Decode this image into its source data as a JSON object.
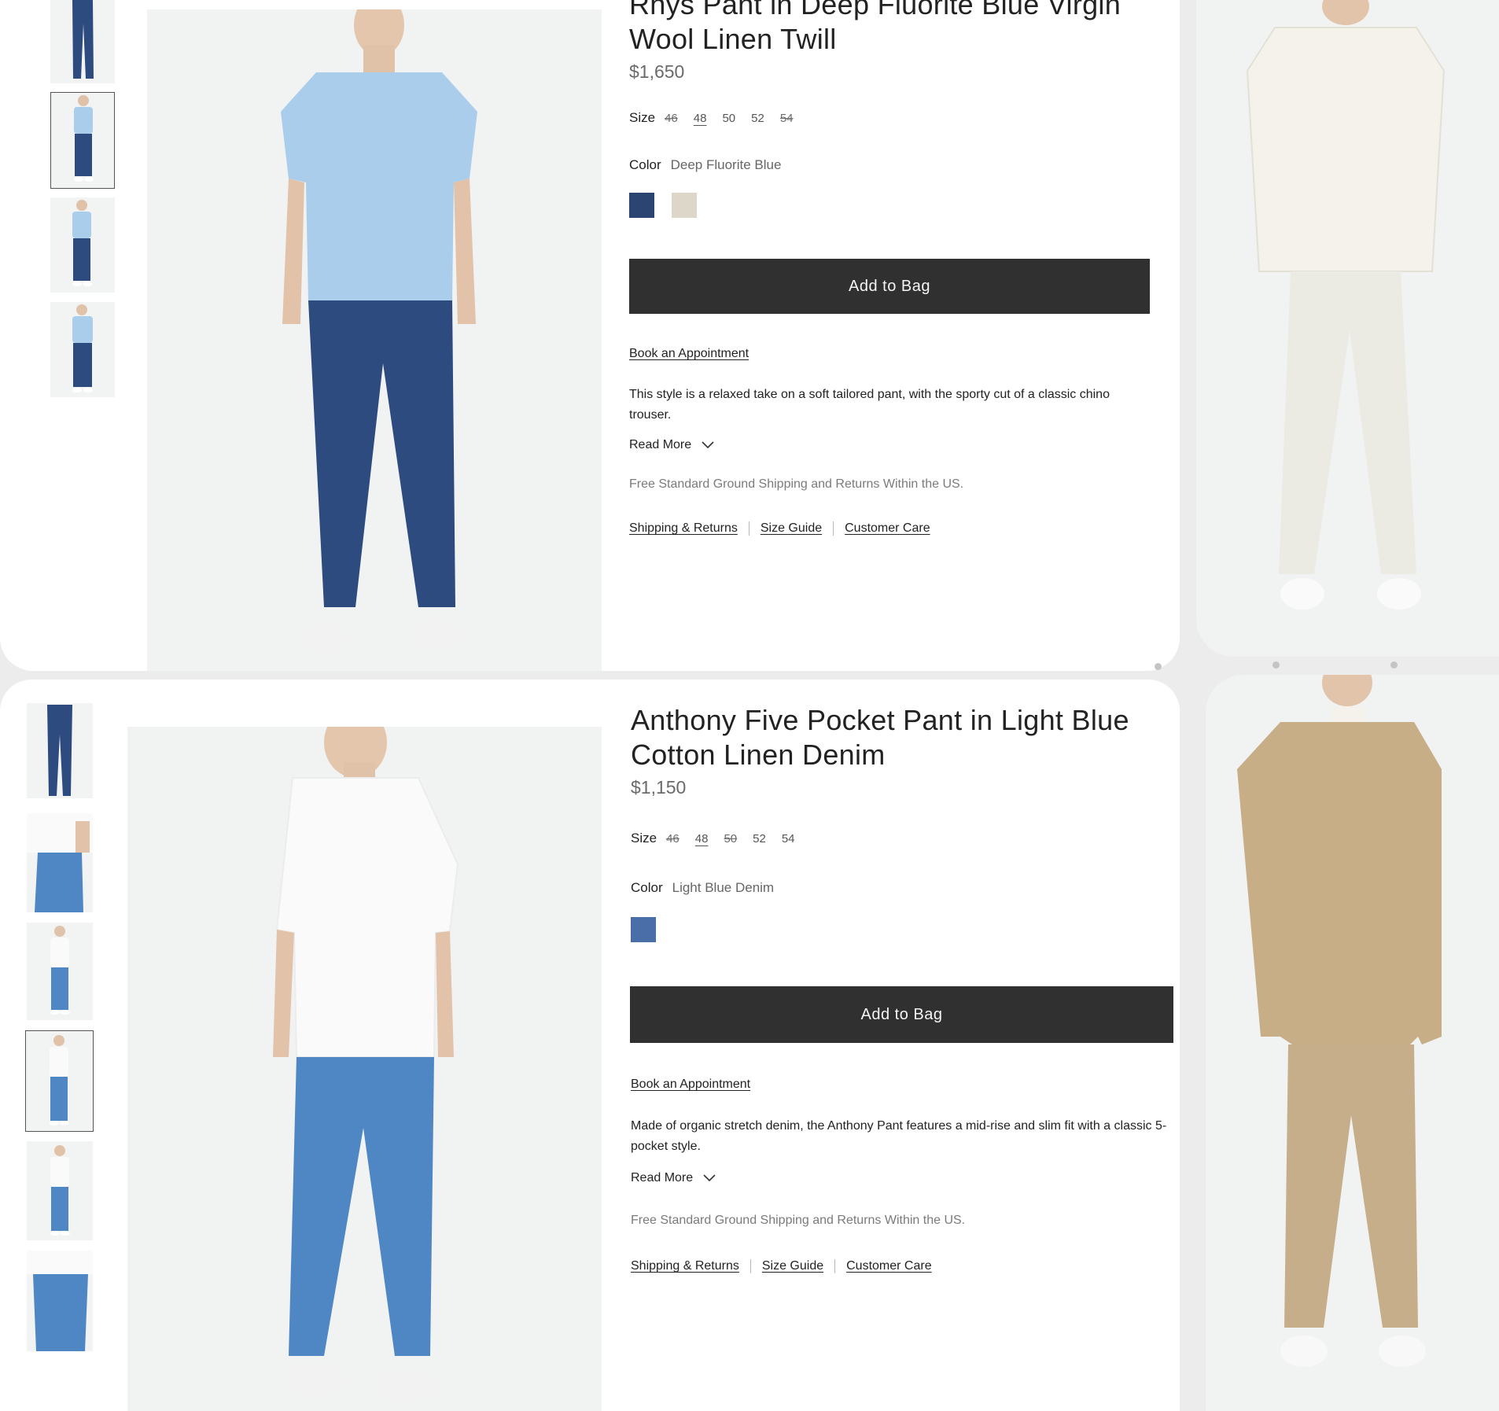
{
  "product_1": {
    "title": "Rhys Pant in Deep Fluorite Blue Virgin Wool Linen Twill",
    "price": "$1,650",
    "size_label": "Size",
    "sizes": [
      {
        "label": "46",
        "available": false
      },
      {
        "label": "48",
        "selected": true
      },
      {
        "label": "50"
      },
      {
        "label": "52"
      },
      {
        "label": "54",
        "available": false
      }
    ],
    "color_label": "Color",
    "color_value": "Deep Fluorite Blue",
    "swatches": [
      "#2c4471",
      "#ddd7c9"
    ],
    "add_to_bag": "Add to Bag",
    "appointment": "Book an Appointment",
    "description": "This style is a relaxed take on a soft tailored pant, with the sporty cut of a classic chino trouser.",
    "read_more": "Read More",
    "shipping_note": "Free Standard Ground Shipping and Returns Within the US.",
    "links": [
      "Shipping & Returns",
      "Size Guide",
      "Customer Care"
    ],
    "image_outfit": {
      "top": "#a9cdeb",
      "pants": "#2e4b80",
      "shoes": "#f1f1f1"
    }
  },
  "product_2": {
    "title": "Anthony Five Pocket Pant in Light Blue Cotton Linen Denim",
    "price": "$1,150",
    "size_label": "Size",
    "sizes": [
      {
        "label": "46",
        "available": false
      },
      {
        "label": "48",
        "selected": true
      },
      {
        "label": "50",
        "available": false
      },
      {
        "label": "52"
      },
      {
        "label": "54"
      }
    ],
    "color_label": "Color",
    "color_value": "Light Blue Denim",
    "swatches": [
      "#4a6fa8"
    ],
    "add_to_bag": "Add to Bag",
    "appointment": "Book an Appointment",
    "description": "Made of organic stretch denim, the Anthony Pant features a mid-rise and slim fit with a classic 5-pocket style.",
    "read_more": "Read More",
    "shipping_note": "Free Standard Ground Shipping and Returns Within the US.",
    "links": [
      "Shipping & Returns",
      "Size Guide",
      "Customer Care"
    ],
    "image_outfit": {
      "top": "#fafafa",
      "pants": "#4f87c5",
      "shoes": "#f1f1f1"
    }
  },
  "side_1": {
    "top": "#f4f2ea",
    "pants": "#ecebe3"
  },
  "side_2": {
    "top": "#c8ae87",
    "pants": "#c6ae8a"
  }
}
